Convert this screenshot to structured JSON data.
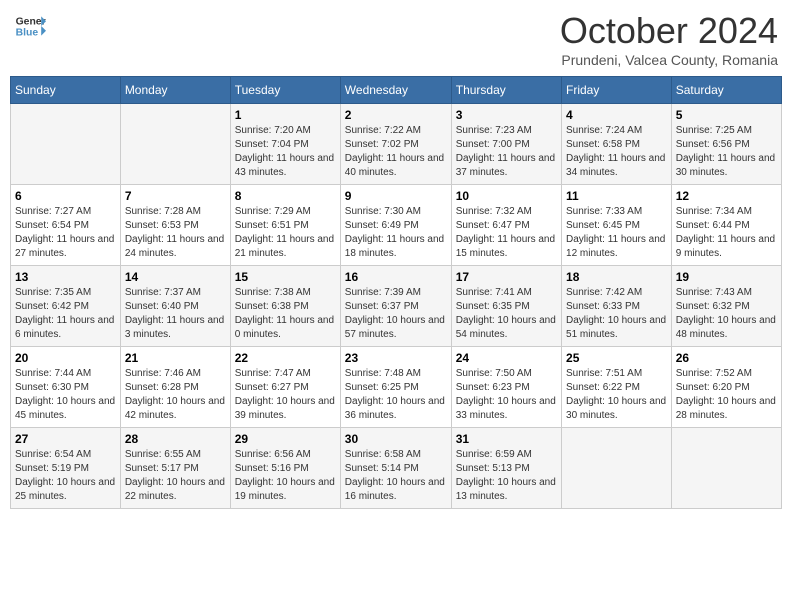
{
  "header": {
    "logo_line1": "General",
    "logo_line2": "Blue",
    "month": "October 2024",
    "location": "Prundeni, Valcea County, Romania"
  },
  "weekdays": [
    "Sunday",
    "Monday",
    "Tuesday",
    "Wednesday",
    "Thursday",
    "Friday",
    "Saturday"
  ],
  "weeks": [
    [
      {
        "day": "",
        "sunrise": "",
        "sunset": "",
        "daylight": ""
      },
      {
        "day": "",
        "sunrise": "",
        "sunset": "",
        "daylight": ""
      },
      {
        "day": "1",
        "sunrise": "Sunrise: 7:20 AM",
        "sunset": "Sunset: 7:04 PM",
        "daylight": "Daylight: 11 hours and 43 minutes."
      },
      {
        "day": "2",
        "sunrise": "Sunrise: 7:22 AM",
        "sunset": "Sunset: 7:02 PM",
        "daylight": "Daylight: 11 hours and 40 minutes."
      },
      {
        "day": "3",
        "sunrise": "Sunrise: 7:23 AM",
        "sunset": "Sunset: 7:00 PM",
        "daylight": "Daylight: 11 hours and 37 minutes."
      },
      {
        "day": "4",
        "sunrise": "Sunrise: 7:24 AM",
        "sunset": "Sunset: 6:58 PM",
        "daylight": "Daylight: 11 hours and 34 minutes."
      },
      {
        "day": "5",
        "sunrise": "Sunrise: 7:25 AM",
        "sunset": "Sunset: 6:56 PM",
        "daylight": "Daylight: 11 hours and 30 minutes."
      }
    ],
    [
      {
        "day": "6",
        "sunrise": "Sunrise: 7:27 AM",
        "sunset": "Sunset: 6:54 PM",
        "daylight": "Daylight: 11 hours and 27 minutes."
      },
      {
        "day": "7",
        "sunrise": "Sunrise: 7:28 AM",
        "sunset": "Sunset: 6:53 PM",
        "daylight": "Daylight: 11 hours and 24 minutes."
      },
      {
        "day": "8",
        "sunrise": "Sunrise: 7:29 AM",
        "sunset": "Sunset: 6:51 PM",
        "daylight": "Daylight: 11 hours and 21 minutes."
      },
      {
        "day": "9",
        "sunrise": "Sunrise: 7:30 AM",
        "sunset": "Sunset: 6:49 PM",
        "daylight": "Daylight: 11 hours and 18 minutes."
      },
      {
        "day": "10",
        "sunrise": "Sunrise: 7:32 AM",
        "sunset": "Sunset: 6:47 PM",
        "daylight": "Daylight: 11 hours and 15 minutes."
      },
      {
        "day": "11",
        "sunrise": "Sunrise: 7:33 AM",
        "sunset": "Sunset: 6:45 PM",
        "daylight": "Daylight: 11 hours and 12 minutes."
      },
      {
        "day": "12",
        "sunrise": "Sunrise: 7:34 AM",
        "sunset": "Sunset: 6:44 PM",
        "daylight": "Daylight: 11 hours and 9 minutes."
      }
    ],
    [
      {
        "day": "13",
        "sunrise": "Sunrise: 7:35 AM",
        "sunset": "Sunset: 6:42 PM",
        "daylight": "Daylight: 11 hours and 6 minutes."
      },
      {
        "day": "14",
        "sunrise": "Sunrise: 7:37 AM",
        "sunset": "Sunset: 6:40 PM",
        "daylight": "Daylight: 11 hours and 3 minutes."
      },
      {
        "day": "15",
        "sunrise": "Sunrise: 7:38 AM",
        "sunset": "Sunset: 6:38 PM",
        "daylight": "Daylight: 11 hours and 0 minutes."
      },
      {
        "day": "16",
        "sunrise": "Sunrise: 7:39 AM",
        "sunset": "Sunset: 6:37 PM",
        "daylight": "Daylight: 10 hours and 57 minutes."
      },
      {
        "day": "17",
        "sunrise": "Sunrise: 7:41 AM",
        "sunset": "Sunset: 6:35 PM",
        "daylight": "Daylight: 10 hours and 54 minutes."
      },
      {
        "day": "18",
        "sunrise": "Sunrise: 7:42 AM",
        "sunset": "Sunset: 6:33 PM",
        "daylight": "Daylight: 10 hours and 51 minutes."
      },
      {
        "day": "19",
        "sunrise": "Sunrise: 7:43 AM",
        "sunset": "Sunset: 6:32 PM",
        "daylight": "Daylight: 10 hours and 48 minutes."
      }
    ],
    [
      {
        "day": "20",
        "sunrise": "Sunrise: 7:44 AM",
        "sunset": "Sunset: 6:30 PM",
        "daylight": "Daylight: 10 hours and 45 minutes."
      },
      {
        "day": "21",
        "sunrise": "Sunrise: 7:46 AM",
        "sunset": "Sunset: 6:28 PM",
        "daylight": "Daylight: 10 hours and 42 minutes."
      },
      {
        "day": "22",
        "sunrise": "Sunrise: 7:47 AM",
        "sunset": "Sunset: 6:27 PM",
        "daylight": "Daylight: 10 hours and 39 minutes."
      },
      {
        "day": "23",
        "sunrise": "Sunrise: 7:48 AM",
        "sunset": "Sunset: 6:25 PM",
        "daylight": "Daylight: 10 hours and 36 minutes."
      },
      {
        "day": "24",
        "sunrise": "Sunrise: 7:50 AM",
        "sunset": "Sunset: 6:23 PM",
        "daylight": "Daylight: 10 hours and 33 minutes."
      },
      {
        "day": "25",
        "sunrise": "Sunrise: 7:51 AM",
        "sunset": "Sunset: 6:22 PM",
        "daylight": "Daylight: 10 hours and 30 minutes."
      },
      {
        "day": "26",
        "sunrise": "Sunrise: 7:52 AM",
        "sunset": "Sunset: 6:20 PM",
        "daylight": "Daylight: 10 hours and 28 minutes."
      }
    ],
    [
      {
        "day": "27",
        "sunrise": "Sunrise: 6:54 AM",
        "sunset": "Sunset: 5:19 PM",
        "daylight": "Daylight: 10 hours and 25 minutes."
      },
      {
        "day": "28",
        "sunrise": "Sunrise: 6:55 AM",
        "sunset": "Sunset: 5:17 PM",
        "daylight": "Daylight: 10 hours and 22 minutes."
      },
      {
        "day": "29",
        "sunrise": "Sunrise: 6:56 AM",
        "sunset": "Sunset: 5:16 PM",
        "daylight": "Daylight: 10 hours and 19 minutes."
      },
      {
        "day": "30",
        "sunrise": "Sunrise: 6:58 AM",
        "sunset": "Sunset: 5:14 PM",
        "daylight": "Daylight: 10 hours and 16 minutes."
      },
      {
        "day": "31",
        "sunrise": "Sunrise: 6:59 AM",
        "sunset": "Sunset: 5:13 PM",
        "daylight": "Daylight: 10 hours and 13 minutes."
      },
      {
        "day": "",
        "sunrise": "",
        "sunset": "",
        "daylight": ""
      },
      {
        "day": "",
        "sunrise": "",
        "sunset": "",
        "daylight": ""
      }
    ]
  ]
}
